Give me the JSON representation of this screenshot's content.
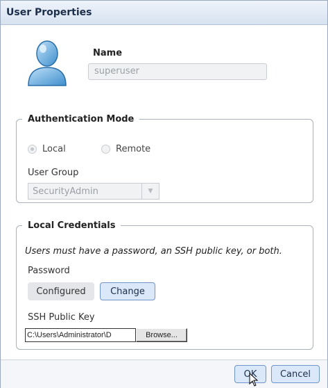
{
  "dialog": {
    "title": "User Properties"
  },
  "user": {
    "name_label": "Name",
    "name_value": "superuser"
  },
  "auth": {
    "legend": "Authentication Mode",
    "options": [
      {
        "label": "Local",
        "selected": true
      },
      {
        "label": "Remote",
        "selected": false
      }
    ],
    "group_label": "User Group",
    "group_value": "SecurityAdmin"
  },
  "creds": {
    "legend": "Local Credentials",
    "note": "Users must have a password, an SSH public key, or both.",
    "password_label": "Password",
    "password_status": "Configured",
    "change_label": "Change",
    "ssh_label": "SSH Public Key",
    "ssh_path": "C:\\Users\\Administrator\\D",
    "browse_label": "Browse..."
  },
  "footer": {
    "ok_label": "OK",
    "cancel_label": "Cancel"
  },
  "icons": {
    "user": "user-silhouette-icon",
    "cursor": "mouse-pointer-icon",
    "dropdown": "chevron-down-icon"
  },
  "colors": {
    "accent": "#6f94c9",
    "titlebar": "#d7e2f0",
    "button_fill": "#dbe8fa"
  }
}
